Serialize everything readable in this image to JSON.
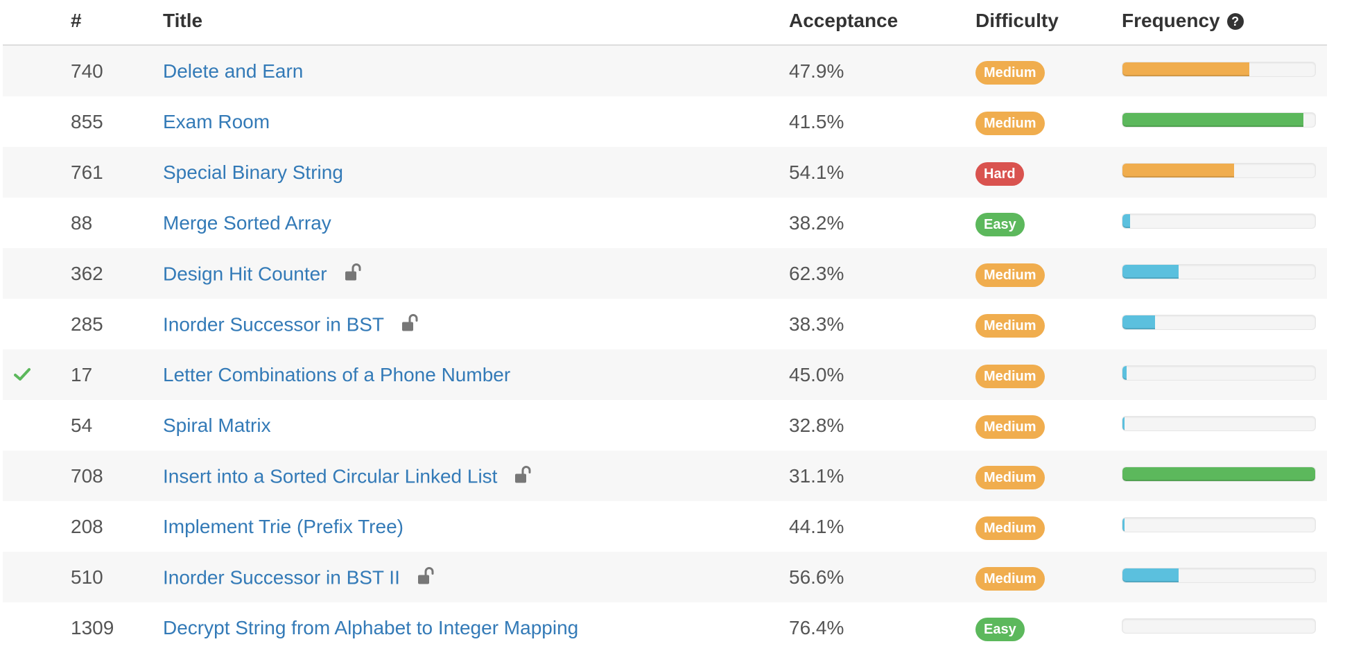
{
  "table": {
    "headers": {
      "status": "",
      "num": "#",
      "title": "Title",
      "acceptance": "Acceptance",
      "difficulty": "Difficulty",
      "frequency": "Frequency",
      "frequency_help_icon": "question-circle-icon"
    },
    "colors": {
      "link": "#337ab7",
      "medium": "#f0ad4e",
      "hard": "#d9534f",
      "easy": "#5cb85c",
      "freq_orange": "#f0ad4e",
      "freq_green": "#5cb85c",
      "freq_blue": "#5bc0de",
      "solved_check": "#5cb85c"
    },
    "rows": [
      {
        "solved": false,
        "num": "740",
        "title": "Delete and Earn",
        "locked": false,
        "acceptance": "47.9%",
        "difficulty": "Medium",
        "difficulty_level": "medium",
        "frequency": 0.66,
        "frequency_color": "orange"
      },
      {
        "solved": false,
        "num": "855",
        "title": "Exam Room",
        "locked": false,
        "acceptance": "41.5%",
        "difficulty": "Medium",
        "difficulty_level": "medium",
        "frequency": 0.94,
        "frequency_color": "green"
      },
      {
        "solved": false,
        "num": "761",
        "title": "Special Binary String",
        "locked": false,
        "acceptance": "54.1%",
        "difficulty": "Hard",
        "difficulty_level": "hard",
        "frequency": 0.58,
        "frequency_color": "orange"
      },
      {
        "solved": false,
        "num": "88",
        "title": "Merge Sorted Array",
        "locked": false,
        "acceptance": "38.2%",
        "difficulty": "Easy",
        "difficulty_level": "easy",
        "frequency": 0.04,
        "frequency_color": "blue"
      },
      {
        "solved": false,
        "num": "362",
        "title": "Design Hit Counter",
        "locked": true,
        "acceptance": "62.3%",
        "difficulty": "Medium",
        "difficulty_level": "medium",
        "frequency": 0.29,
        "frequency_color": "blue"
      },
      {
        "solved": false,
        "num": "285",
        "title": "Inorder Successor in BST",
        "locked": true,
        "acceptance": "38.3%",
        "difficulty": "Medium",
        "difficulty_level": "medium",
        "frequency": 0.17,
        "frequency_color": "blue"
      },
      {
        "solved": true,
        "num": "17",
        "title": "Letter Combinations of a Phone Number",
        "locked": false,
        "acceptance": "45.0%",
        "difficulty": "Medium",
        "difficulty_level": "medium",
        "frequency": 0.02,
        "frequency_color": "blue"
      },
      {
        "solved": false,
        "num": "54",
        "title": "Spiral Matrix",
        "locked": false,
        "acceptance": "32.8%",
        "difficulty": "Medium",
        "difficulty_level": "medium",
        "frequency": 0.01,
        "frequency_color": "blue"
      },
      {
        "solved": false,
        "num": "708",
        "title": "Insert into a Sorted Circular Linked List",
        "locked": true,
        "acceptance": "31.1%",
        "difficulty": "Medium",
        "difficulty_level": "medium",
        "frequency": 1.0,
        "frequency_color": "green"
      },
      {
        "solved": false,
        "num": "208",
        "title": "Implement Trie (Prefix Tree)",
        "locked": false,
        "acceptance": "44.1%",
        "difficulty": "Medium",
        "difficulty_level": "medium",
        "frequency": 0.01,
        "frequency_color": "blue"
      },
      {
        "solved": false,
        "num": "510",
        "title": "Inorder Successor in BST II",
        "locked": true,
        "acceptance": "56.6%",
        "difficulty": "Medium",
        "difficulty_level": "medium",
        "frequency": 0.29,
        "frequency_color": "blue"
      },
      {
        "solved": false,
        "num": "1309",
        "title": "Decrypt String from Alphabet to Integer Mapping",
        "locked": false,
        "acceptance": "76.4%",
        "difficulty": "Easy",
        "difficulty_level": "easy",
        "frequency": 0.0,
        "frequency_color": "blue"
      }
    ]
  }
}
